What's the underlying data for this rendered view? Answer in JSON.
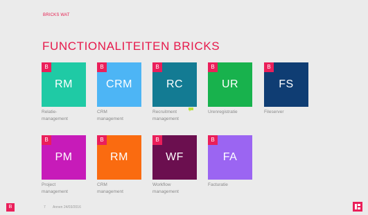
{
  "header": {
    "kicker": "BRICKS WAT",
    "title": "FUNCTIONALITEITEN BRICKS"
  },
  "badge_label": "B",
  "tiles": [
    {
      "abbr": "RM",
      "caption1": "Relatie-",
      "caption2": "management",
      "color": "#1fcaa5"
    },
    {
      "abbr": "CRM",
      "caption1": "CRM",
      "caption2": "management",
      "color": "#4db5f5"
    },
    {
      "abbr": "RC",
      "caption1": "Recruitment",
      "caption2": "management",
      "color": "#137b93"
    },
    {
      "abbr": "UR",
      "caption1": "Urenregistratie",
      "caption2": "",
      "color": "#18b24d"
    },
    {
      "abbr": "FS",
      "caption1": "Fileserver",
      "caption2": "",
      "color": "#0f3d73"
    },
    {
      "abbr": "PM",
      "caption1": "Project",
      "caption2": "management",
      "color": "#c71bb9"
    },
    {
      "abbr": "RM",
      "caption1": "CRM",
      "caption2": "management",
      "color": "#fa6b10"
    },
    {
      "abbr": "WF",
      "caption1": "Workflow",
      "caption2": "management",
      "color": "#6b0f4f"
    },
    {
      "abbr": "FA",
      "caption1": "Facturatie",
      "caption2": "",
      "color": "#9b65f2"
    }
  ],
  "footer": {
    "logo_letter": "B",
    "page_number": "7",
    "author_date": "Annen 24/03/2016"
  },
  "colors": {
    "accent": "#e6194b",
    "background": "#ebebeb",
    "note_icon": "#b9e23b"
  },
  "icons": {
    "comment": "comment-note-icon"
  }
}
